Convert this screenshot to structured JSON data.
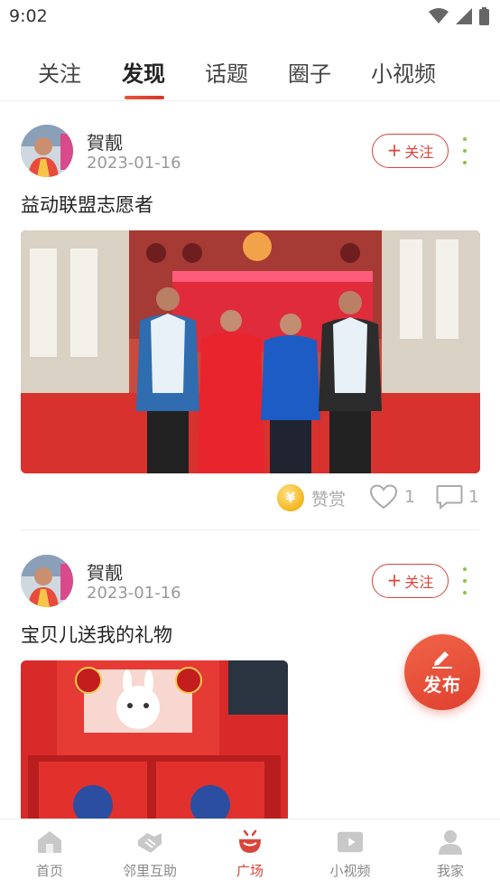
{
  "status_bar": {
    "time": "9:02"
  },
  "top_tabs": [
    {
      "label": "关注"
    },
    {
      "label": "发现",
      "active": true
    },
    {
      "label": "话题"
    },
    {
      "label": "圈子"
    },
    {
      "label": "小视频"
    }
  ],
  "posts": [
    {
      "author": "賀靓",
      "date": "2023-01-16",
      "follow_label": "关注",
      "text": "益动联盟志愿者",
      "reward_label": "赞赏",
      "likes": "1",
      "comments": "1"
    },
    {
      "author": "賀靓",
      "date": "2023-01-16",
      "follow_label": "关注",
      "text": "宝贝儿送我的礼物"
    }
  ],
  "fab": {
    "label": "发布"
  },
  "bottom_nav": [
    {
      "label": "首页",
      "icon": "home-icon"
    },
    {
      "label": "邻里互助",
      "icon": "handshake-icon"
    },
    {
      "label": "广场",
      "icon": "plaza-icon",
      "active": true
    },
    {
      "label": "小视频",
      "icon": "video-icon"
    },
    {
      "label": "我家",
      "icon": "profile-icon"
    }
  ],
  "colors": {
    "accent": "#d9453b",
    "active_green": "#8bc34a",
    "muted": "#999999"
  }
}
